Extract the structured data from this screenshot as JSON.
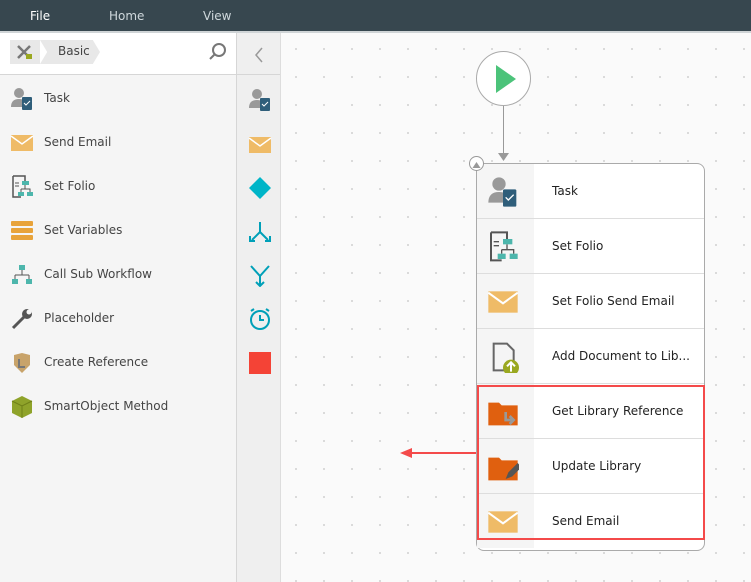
{
  "menu": {
    "file": "File",
    "home": "Home",
    "view": "View"
  },
  "toolbox": {
    "breadcrumb": "Basic",
    "items": [
      {
        "label": "Task",
        "icon": "task-icon"
      },
      {
        "label": "Send Email",
        "icon": "email-icon"
      },
      {
        "label": "Set Folio",
        "icon": "folio-icon"
      },
      {
        "label": "Set Variables",
        "icon": "variables-icon"
      },
      {
        "label": "Call Sub Workflow",
        "icon": "sub-workflow-icon"
      },
      {
        "label": "Placeholder",
        "icon": "wrench-icon"
      },
      {
        "label": "Create Reference",
        "icon": "reference-icon"
      },
      {
        "label": "SmartObject Method",
        "icon": "smartobject-icon"
      }
    ]
  },
  "step": {
    "rows": [
      {
        "label": "Task"
      },
      {
        "label": "Set Folio"
      },
      {
        "label": "Set Folio Send Email"
      },
      {
        "label": "Add Document to Lib..."
      },
      {
        "label": "Get Library Reference"
      },
      {
        "label": "Update Library"
      },
      {
        "label": "Send Email"
      }
    ]
  },
  "colors": {
    "topbar": "#37474f",
    "highlight": "#f44a4a",
    "start": "#4cc37a",
    "email": "#efbb67",
    "folder": "#e0600f",
    "teal": "#00b5c8",
    "stop": "#f44336"
  }
}
